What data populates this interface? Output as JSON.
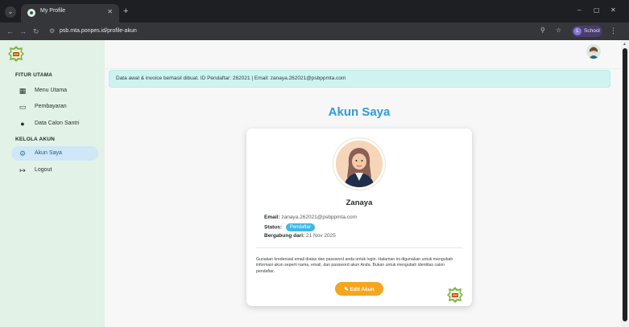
{
  "browser": {
    "tab_title": "My Profile",
    "tab_close": "✕",
    "new_tab": "+",
    "url": "psb.mta.ponpes.id/profile-akun",
    "profile_initial": "L",
    "profile_label": "School",
    "window": {
      "minimize": "–",
      "maximize": "▢",
      "close": "✕"
    }
  },
  "sidebar": {
    "sections": [
      {
        "title": "FITUR UTAMA"
      },
      {
        "title": "KELOLA AKUN"
      }
    ],
    "items": [
      {
        "label": "Menu Utama",
        "icon": "grid-icon"
      },
      {
        "label": "Pembayaran",
        "icon": "credit-card-icon"
      },
      {
        "label": "Data Calon Santri",
        "icon": "user-icon"
      },
      {
        "label": "Akun Saya",
        "icon": "user-gear-icon",
        "active": true
      },
      {
        "label": "Logout",
        "icon": "logout-icon"
      }
    ]
  },
  "alert": {
    "text": "Data awal & invoice berhasil dibuat. ID Pendaftar: 262021 | Email: zanaya.262021@psbppmta.com"
  },
  "page": {
    "title": "Akun Saya"
  },
  "profile": {
    "name": "Zanaya",
    "email_label": "Email:",
    "email": "zanaya.262021@psbppmta.com",
    "status_label": "Status:",
    "status": "Pendaftar",
    "joined_label": "Bergabung dari:",
    "joined": "21 Nov 2025",
    "description": "Gunakan kredensial email diatas dan password anda untuk login. Halaman ini digunakan untuk mengubah informasi akun seperti nama, email, dan password akun Anda. Bukan untuk mengubah identitas calon pendaftar.",
    "edit_button": "✎ Edit Akun"
  },
  "colors": {
    "accent": "#2f9bd9",
    "sidebar_bg": "#e2f2e6",
    "alert_bg": "#cff4f0",
    "status_badge": "#3fb8e6",
    "edit_button": "#f4a61d"
  }
}
